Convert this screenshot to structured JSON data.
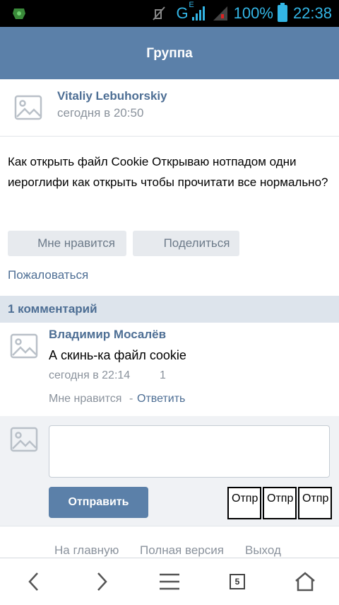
{
  "status_bar": {
    "network": "G",
    "network_sup": "E",
    "battery": "100%",
    "time": "22:38",
    "accent": "#33b5e5"
  },
  "header": {
    "title": "Группа"
  },
  "post": {
    "author": "Vitaliy Lebuhorskiy",
    "date": "сегодня в 20:50",
    "text": "Как открыть файл Cookie Открываю нотпадом одни иероглифи как открыть чтобы прочитати все нормально?",
    "like_label": "Мне нравится",
    "share_label": "Поделиться",
    "report_label": "Пожаловаться"
  },
  "comments": {
    "title": "1 комментарий",
    "items": [
      {
        "author": "Владимир Мосалёв",
        "text": "А скинь-ка файл cookie",
        "date": "сегодня в 22:14",
        "likes": "1",
        "like_label": "Мне нравится",
        "separator": "-",
        "reply_label": "Ответить"
      }
    ]
  },
  "reply_form": {
    "send_label": "Отправить",
    "extra_buttons": [
      "Отпр",
      "Отпр",
      "Отпр"
    ]
  },
  "footer": {
    "links": [
      "На главную",
      "Полная версия",
      "Выход"
    ]
  },
  "navbar": {
    "tab_count": "5",
    "icons": [
      "chevron-left-icon",
      "chevron-right-icon",
      "menu-icon",
      "tabs-icon",
      "home-icon"
    ]
  },
  "colors": {
    "header_bg": "#5b80a9",
    "link": "#4d6e94",
    "muted": "#8a929c",
    "comments_bar": "#dde4ec"
  }
}
